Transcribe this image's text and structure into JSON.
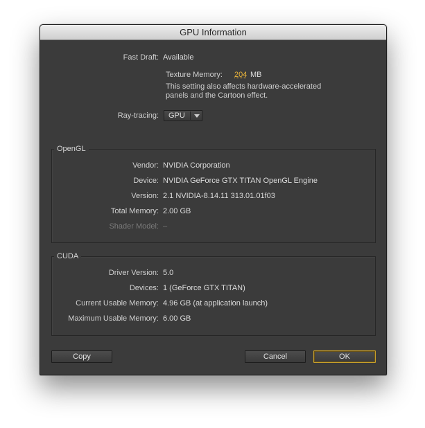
{
  "window": {
    "title": "GPU Information"
  },
  "general": {
    "fast_draft_label": "Fast Draft:",
    "fast_draft_value": "Available",
    "texture_memory_label": "Texture Memory:",
    "texture_memory_value": "204",
    "texture_memory_unit": "MB",
    "note_line1": "This setting also affects hardware-accelerated",
    "note_line2": "panels and the Cartoon effect.",
    "ray_tracing_label": "Ray-tracing:",
    "ray_tracing_value": "GPU"
  },
  "opengl": {
    "title": "OpenGL",
    "rows": [
      {
        "label": "Vendor:",
        "value": "NVIDIA Corporation"
      },
      {
        "label": "Device:",
        "value": "NVIDIA GeForce GTX TITAN OpenGL Engine"
      },
      {
        "label": "Version:",
        "value": "2.1 NVIDIA-8.14.11 313.01.01f03"
      },
      {
        "label": "Total Memory:",
        "value": "2.00 GB"
      },
      {
        "label": "Shader Model:",
        "value": "–"
      }
    ]
  },
  "cuda": {
    "title": "CUDA",
    "rows": [
      {
        "label": "Driver Version:",
        "value": "5.0"
      },
      {
        "label": "Devices:",
        "value": "1 (GeForce GTX TITAN)"
      },
      {
        "label": "Current Usable Memory:",
        "value": "4.96 GB (at application launch)"
      },
      {
        "label": "Maximum Usable Memory:",
        "value": "6.00 GB"
      }
    ]
  },
  "buttons": {
    "copy": "Copy",
    "cancel": "Cancel",
    "ok": "OK"
  },
  "colors": {
    "accent": "#e8b33a",
    "background": "#3b3b3b"
  }
}
